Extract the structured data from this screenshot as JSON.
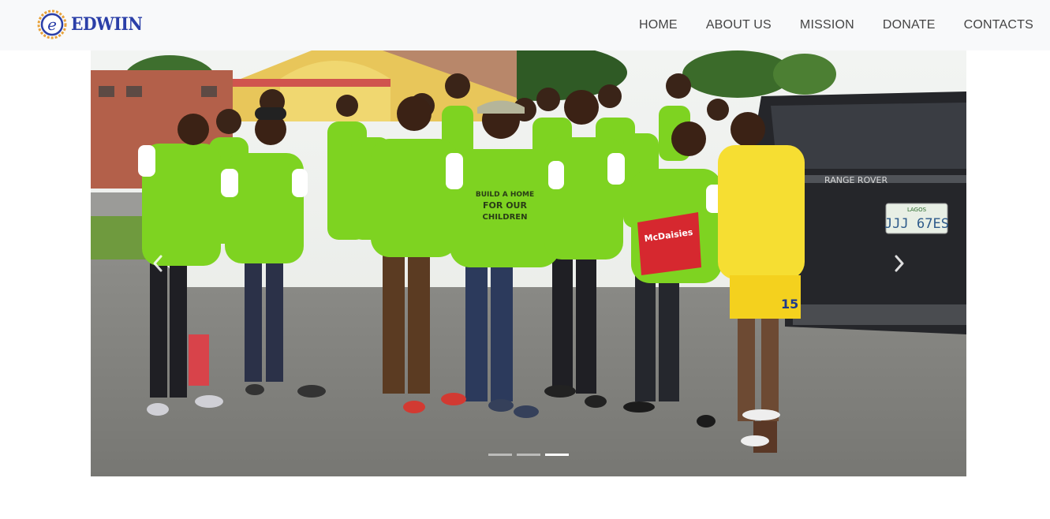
{
  "brand": {
    "name": "EDWIIN",
    "logo_letter": "e"
  },
  "nav": {
    "items": [
      {
        "label": "HOME"
      },
      {
        "label": "ABOUT US"
      },
      {
        "label": "MISSION"
      },
      {
        "label": "DONATE"
      },
      {
        "label": "CONTACTS"
      }
    ]
  },
  "carousel": {
    "slide_count": 3,
    "active_index": 2,
    "prev_icon": "chevron-left-icon",
    "next_icon": "chevron-right-icon",
    "photo": {
      "shirt_text": [
        "BUILD A HOME",
        "FOR OUR",
        "CHILDREN"
      ],
      "bag_text": "McDaisies",
      "plate_text": "JJJ 67ES",
      "plate_top": "LAGOS",
      "car_text": "RANGE ROVER",
      "jersey_number": "15"
    }
  },
  "colors": {
    "nav_bg": "#f8f9fa",
    "nav_text": "#444444",
    "brand_blue": "#2b3fa8",
    "shirt_green": "#7ed321"
  }
}
